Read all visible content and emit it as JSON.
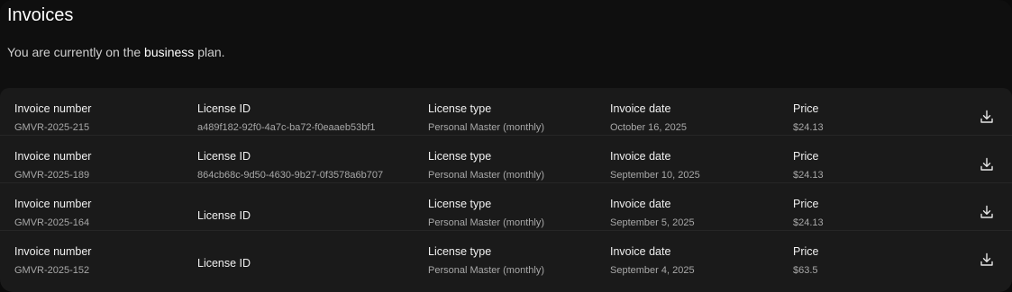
{
  "header": {
    "title": "Invoices",
    "plan_prefix": "You are currently on the",
    "plan_name": "business",
    "plan_suffix": "plan."
  },
  "labels": {
    "invoice_number": "Invoice number",
    "license_id": "License ID",
    "license_type": "License type",
    "invoice_date": "Invoice date",
    "price": "Price"
  },
  "invoices": [
    {
      "invoice_number": "GMVR-2025-215",
      "license_id": "a489f182-92f0-4a7c-ba72-f0eaaeb53bf1",
      "license_type": "Personal Master (monthly)",
      "invoice_date": "October 16, 2025",
      "price": "$24.13"
    },
    {
      "invoice_number": "GMVR-2025-189",
      "license_id": "864cb68c-9d50-4630-9b27-0f3578a6b707",
      "license_type": "Personal Master (monthly)",
      "invoice_date": "September 10, 2025",
      "price": "$24.13"
    },
    {
      "invoice_number": "GMVR-2025-164",
      "license_id": "",
      "license_type": "Personal Master (monthly)",
      "invoice_date": "September 5, 2025",
      "price": "$24.13"
    },
    {
      "invoice_number": "GMVR-2025-152",
      "license_id": "",
      "license_type": "Personal Master (monthly)",
      "invoice_date": "September 4, 2025",
      "price": "$63.5"
    }
  ],
  "icons": {
    "download": "download-icon"
  }
}
